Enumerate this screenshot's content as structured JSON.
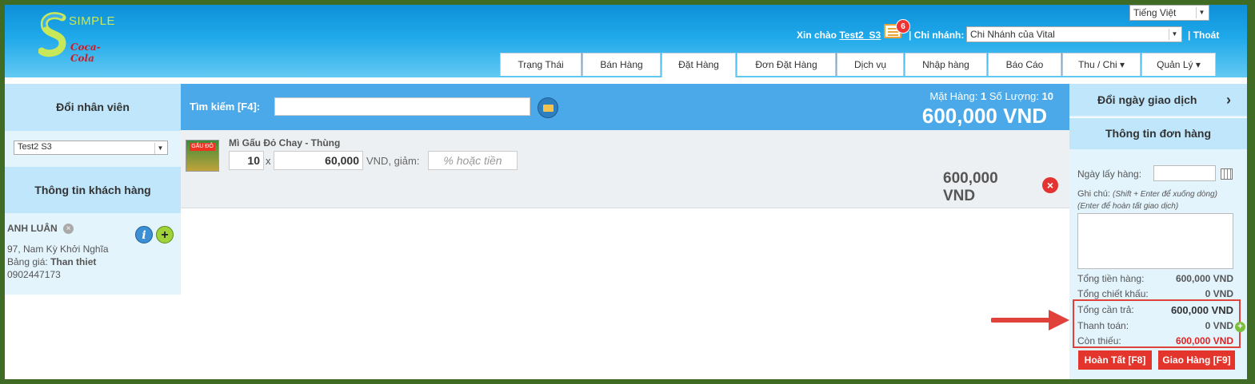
{
  "header": {
    "logo_text": "SIMPLE",
    "logo_brand": "Coca-Cola",
    "language": "Tiếng Việt",
    "greeting_prefix": "Xin chào",
    "username": "Test2_S3",
    "notification_count": "6",
    "branch_label": "| Chi nhánh:",
    "branch_value": "Chi Nhánh của Vital",
    "logout": "| Thoát"
  },
  "tabs": [
    {
      "label": "Trạng Thái"
    },
    {
      "label": "Bán Hàng"
    },
    {
      "label": "Đặt Hàng"
    },
    {
      "label": "Đơn Đặt Hàng"
    },
    {
      "label": "Dịch vụ"
    },
    {
      "label": "Nhập hàng"
    },
    {
      "label": "Báo Cáo"
    },
    {
      "label": "Thu / Chi ▾"
    },
    {
      "label": "Quản Lý ▾"
    }
  ],
  "left": {
    "change_staff": "Đổi nhân viên",
    "staff_selected": "Test2 S3",
    "customer_info": "Thông tin khách hàng",
    "customer_name": "ANH LUÂN",
    "address": "97, Nam Kỳ Khởi Nghĩa",
    "price_list_label": "Bảng giá:",
    "price_list_value": "Than thiet",
    "phone": "0902447173"
  },
  "search": {
    "label": "Tìm kiếm [F4]:",
    "value": "",
    "summary_items_label": "Mặt Hàng:",
    "summary_items": "1",
    "summary_qty_label": "Số Lượng:",
    "summary_qty": "10",
    "total": "600,000 VND"
  },
  "item": {
    "name": "Mì Gấu Đỏ Chay - Thùng",
    "thumb_brand": "GẤU ĐỎ",
    "qty": "10",
    "times": "x",
    "price": "60,000",
    "unit": "VND, giảm:",
    "discount_placeholder": "% hoặc tiền",
    "total_line1": "600,000",
    "total_line2": "VND"
  },
  "right": {
    "change_date": "Đổi ngày giao dịch",
    "order_info": "Thông tin đơn hàng",
    "pickup_label": "Ngày lấy hàng:",
    "note_label": "Ghi chú:",
    "note_hint1": "(Shift + Enter để xuống dòng)",
    "note_hint2": "(Enter để hoàn tất giao dịch)",
    "totals": [
      {
        "label": "Tổng tiền hàng:",
        "value": "600,000 VND"
      },
      {
        "label": "Tổng chiết khấu:",
        "value": "0 VND"
      },
      {
        "label": "Tổng cần trả:",
        "value": "600,000 VND"
      },
      {
        "label": "Thanh toán:",
        "value": "0 VND"
      },
      {
        "label": "Còn thiếu:",
        "value": "600,000 VND"
      }
    ],
    "complete_button": "Hoàn Tất [F8]",
    "delivery_button": "Giao Hàng [F9]"
  }
}
